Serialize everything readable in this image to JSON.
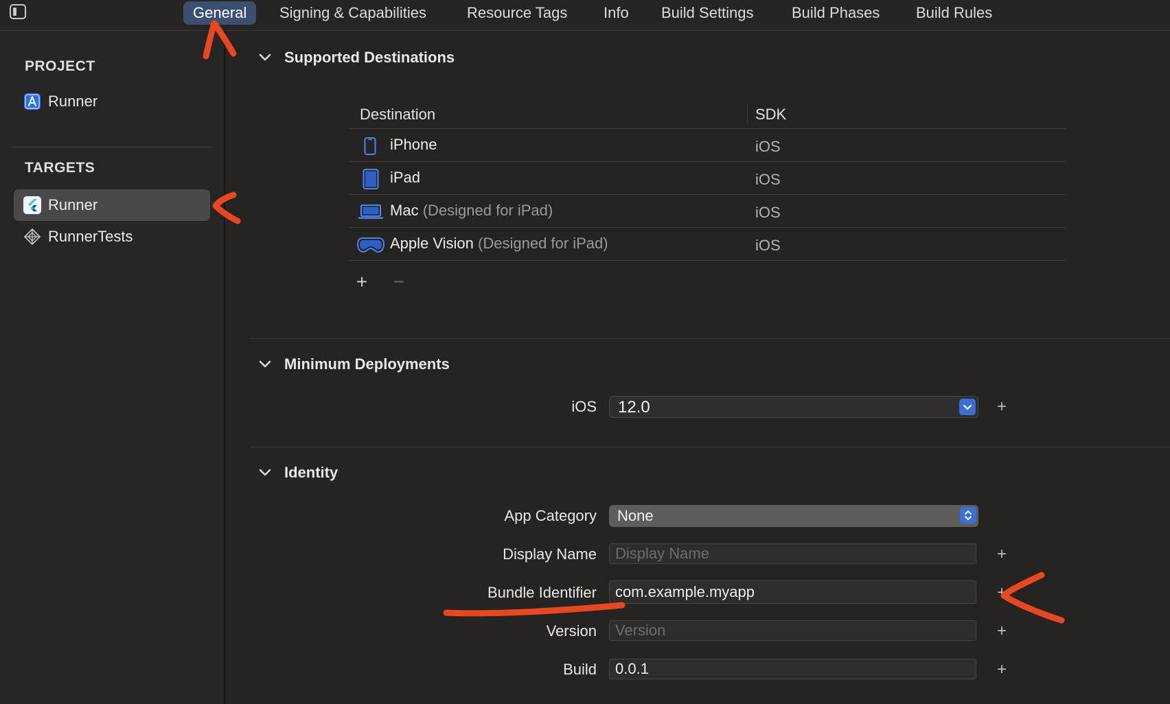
{
  "tabs": [
    {
      "label": "General",
      "active": true
    },
    {
      "label": "Signing & Capabilities"
    },
    {
      "label": "Resource Tags"
    },
    {
      "label": "Info"
    },
    {
      "label": "Build Settings"
    },
    {
      "label": "Build Phases"
    },
    {
      "label": "Build Rules"
    }
  ],
  "sidebar": {
    "project_heading": "PROJECT",
    "project_item": "Runner",
    "targets_heading": "TARGETS",
    "targets": [
      {
        "label": "Runner",
        "selected": true
      },
      {
        "label": "RunnerTests"
      }
    ]
  },
  "supported_destinations": {
    "title": "Supported Destinations",
    "col_destination": "Destination",
    "col_sdk": "SDK",
    "rows": [
      {
        "name": "iPhone",
        "sub": "",
        "sdk": "iOS",
        "icon": "iphone-icon"
      },
      {
        "name": "iPad",
        "sub": "",
        "sdk": "iOS",
        "icon": "ipad-icon"
      },
      {
        "name": "Mac",
        "sub": "(Designed for iPad)",
        "sdk": "iOS",
        "icon": "mac-icon"
      },
      {
        "name": "Apple Vision",
        "sub": "(Designed for iPad)",
        "sdk": "iOS",
        "icon": "vision-pro-icon"
      }
    ],
    "add_symbol": "+",
    "remove_symbol": "−"
  },
  "minimum_deployments": {
    "title": "Minimum Deployments",
    "platform_label": "iOS",
    "version": "12.0",
    "add_symbol": "+"
  },
  "identity": {
    "title": "Identity",
    "app_category_label": "App Category",
    "app_category_value": "None",
    "display_name_label": "Display Name",
    "display_name_placeholder": "Display Name",
    "bundle_identifier_label": "Bundle Identifier",
    "bundle_identifier_value": "com.example.myapp",
    "version_label": "Version",
    "version_placeholder": "Version",
    "build_label": "Build",
    "build_value": "0.0.1",
    "add_symbol": "+"
  },
  "colors": {
    "accent": "#3a6fd8",
    "active_tab": "#3b5070",
    "annotation": "#e8471f"
  }
}
